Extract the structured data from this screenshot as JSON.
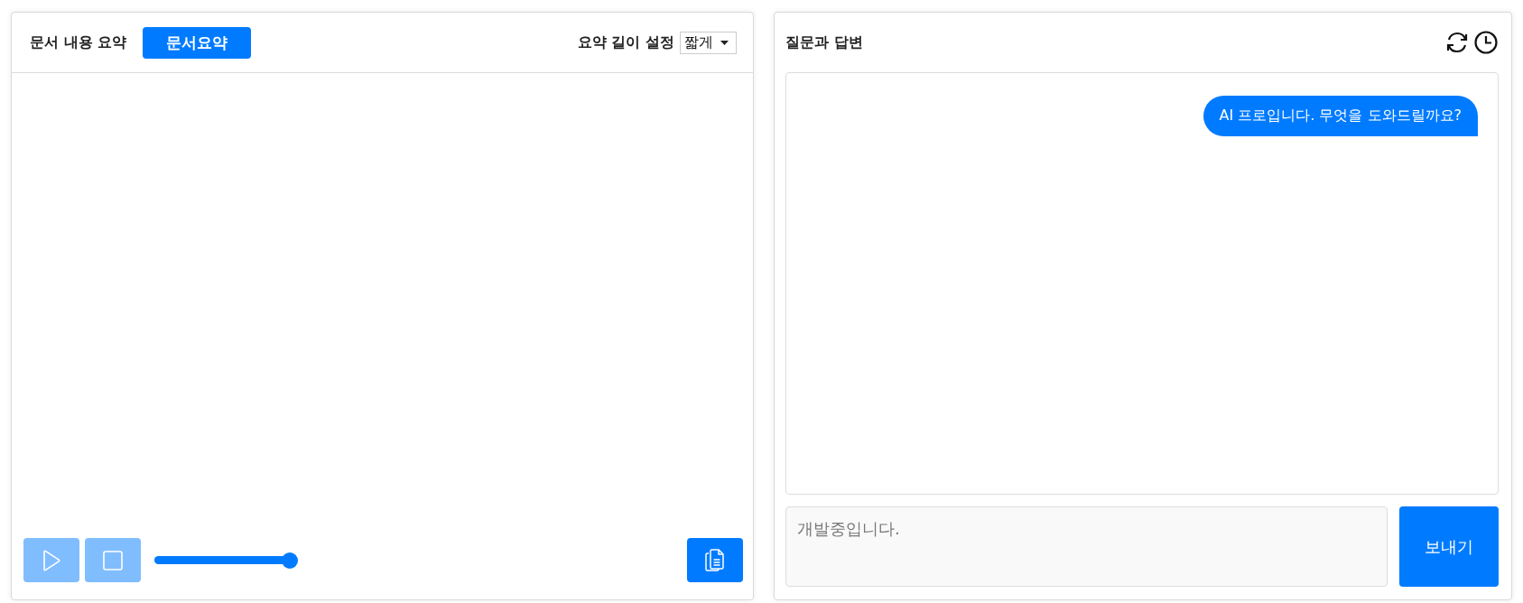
{
  "summary_panel": {
    "title": "문서 내용 요약",
    "summarize_button": "문서요약",
    "length_label": "요약 길이 설정",
    "length_select": "짧게",
    "play_button": {
      "disabled": true
    },
    "stop_button": {
      "disabled": true
    },
    "slider": {
      "level": 1
    }
  },
  "chat_panel": {
    "title": "질문과 답변",
    "messages": [
      {
        "kind": "user",
        "text": "AI 프로입니다. 무엇을 도와드릴까요?"
      }
    ],
    "input": {
      "placeholder": "개발중입니다."
    },
    "send_button": "보내기"
  }
}
